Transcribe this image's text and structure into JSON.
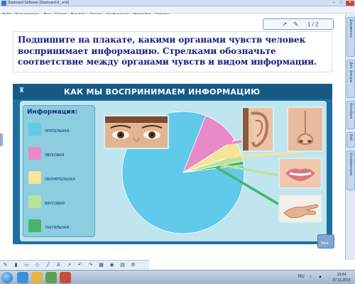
{
  "window": {
    "title": "Starboard Software [Starboard-8_.eml]",
    "controls": {
      "minimize": "–",
      "maximize": "□",
      "close": "×"
    }
  },
  "menu": [
    "Файл",
    "Редактировать",
    "Вид",
    "Сервис",
    "Вставить",
    "Раздел",
    "Конференции",
    "Настройки",
    "Справка"
  ],
  "pager": {
    "text": "1 / 2",
    "cursor_icon": "cursor-icon",
    "pen_icon": "pen-icon"
  },
  "task": {
    "lines": [
      "Подпишите на плакате, какими органами чувств человек",
      "воспринимает информацию. Стрелками обозначьте",
      "соответствие между органами чувств и видом информации."
    ]
  },
  "poster": {
    "title": "КАК МЫ ВОСПРИНИМАЕМ ИНФОРМАЦИЮ",
    "legend_title": "Информация:",
    "legend": [
      {
        "label": "Зрительная",
        "color": "#61c9ea"
      },
      {
        "label": "Звуковая",
        "color": "#e889c8"
      },
      {
        "label": "Обонятельная",
        "color": "#f5e597"
      },
      {
        "label": "Вкусовая",
        "color": "#b9e39b"
      },
      {
        "label": "Тактильная",
        "color": "#47b56b"
      }
    ],
    "photos": [
      "eyes",
      "ear",
      "nose",
      "lips",
      "hand"
    ]
  },
  "chart_data": {
    "type": "pie",
    "title": "КАК МЫ ВОСПРИНИМАЕМ ИНФОРМАЦИЮ",
    "categories": [
      "Зрительная",
      "Звуковая",
      "Обонятельная",
      "Вкусовая",
      "Тактильная"
    ],
    "values": [
      83,
      10,
      4,
      2,
      1
    ],
    "colors": [
      "#61c9ea",
      "#e889c8",
      "#f5e597",
      "#b9e39b",
      "#47b56b"
    ]
  },
  "sidebar_tabs": [
    "Документы",
    "Доп. фигуры",
    "Фотобанк",
    "Веб",
    "Конференции"
  ],
  "next_button": "Next",
  "toolbar_icons": [
    "pen-icon",
    "highlighter-icon",
    "eraser-icon",
    "shape-icon",
    "line-icon",
    "text-icon",
    "select-icon",
    "undo-icon",
    "redo-icon",
    "grid-icon",
    "camera-icon",
    "page-icon",
    "settings-icon"
  ],
  "taskbar": {
    "time": "13:44",
    "date": "07.11.2013"
  }
}
